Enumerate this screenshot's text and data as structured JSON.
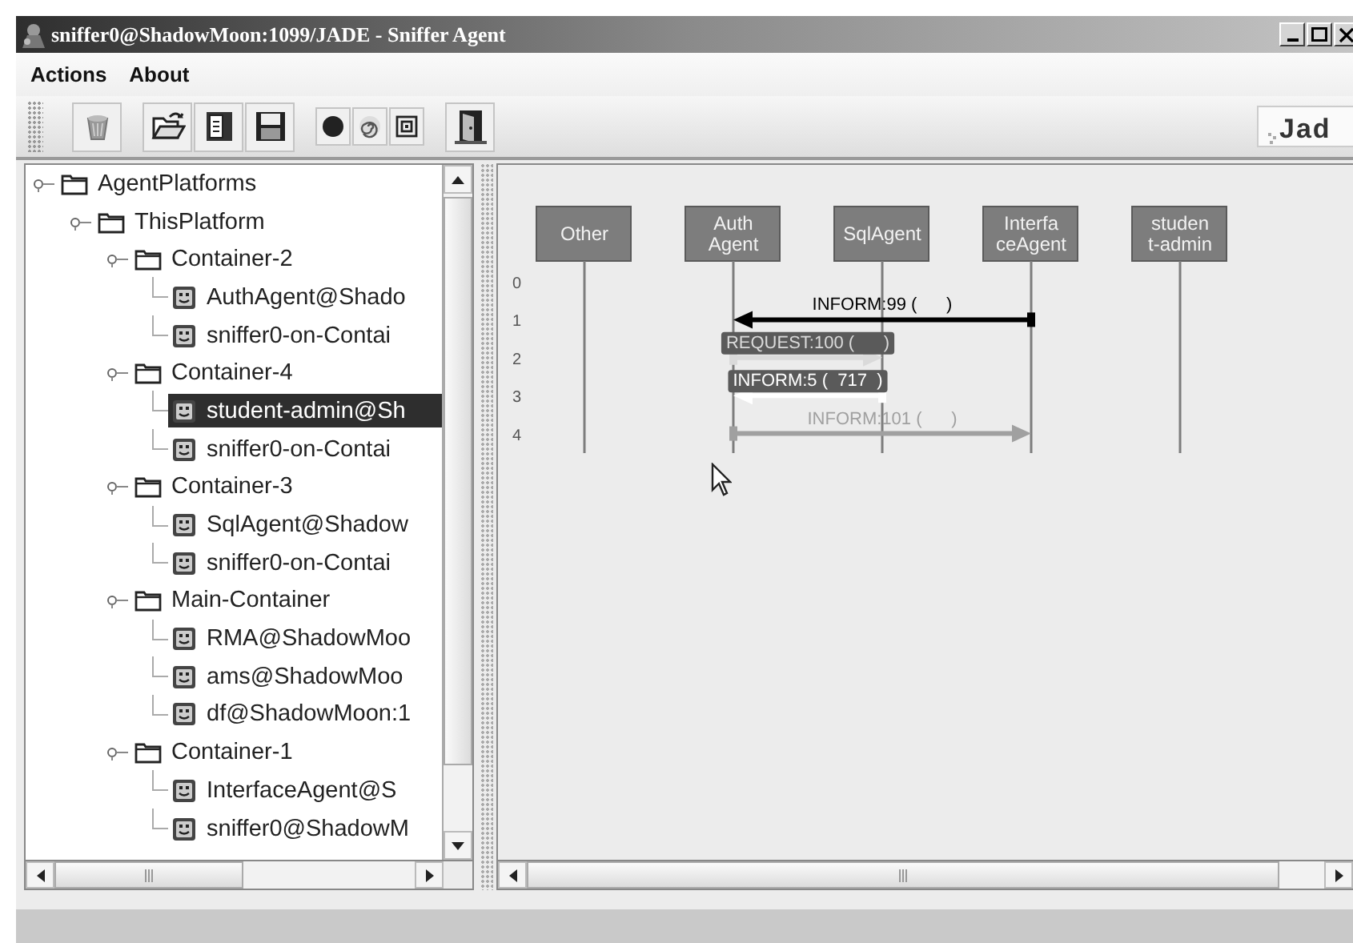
{
  "window": {
    "title": "sniffer0@ShadowMoon:1099/JADE - Sniffer Agent"
  },
  "menu": [
    "Actions",
    "About"
  ],
  "toolbar": {
    "groups": [
      [
        {
          "kind": "trash"
        }
      ],
      [
        {
          "kind": "open"
        },
        {
          "kind": "document"
        },
        {
          "kind": "floppy"
        }
      ],
      [
        {
          "kind": "dot"
        },
        {
          "kind": "spiral"
        },
        {
          "kind": "square"
        }
      ],
      [
        {
          "kind": "door"
        }
      ]
    ],
    "logo": "Jad"
  },
  "tree": [
    {
      "label": "AgentPlatforms",
      "kind": "folder",
      "expanded": true,
      "selected": false,
      "children": [
        {
          "label": "ThisPlatform",
          "kind": "folder",
          "expanded": true,
          "selected": false,
          "children": [
            {
              "label": "Container-2",
              "kind": "folder",
              "expanded": true,
              "selected": false,
              "children": [
                {
                  "label": "AuthAgent@Shado",
                  "kind": "agent",
                  "selected": false
                },
                {
                  "label": "sniffer0-on-Contai",
                  "kind": "agent",
                  "selected": false
                }
              ]
            },
            {
              "label": "Container-4",
              "kind": "folder",
              "expanded": true,
              "selected": false,
              "children": [
                {
                  "label": "student-admin@Sh",
                  "kind": "agent",
                  "selected": true
                },
                {
                  "label": "sniffer0-on-Contai",
                  "kind": "agent",
                  "selected": false
                }
              ]
            },
            {
              "label": "Container-3",
              "kind": "folder",
              "expanded": true,
              "selected": false,
              "children": [
                {
                  "label": "SqlAgent@Shadow",
                  "kind": "agent",
                  "selected": false
                },
                {
                  "label": "sniffer0-on-Contai",
                  "kind": "agent",
                  "selected": false
                }
              ]
            },
            {
              "label": "Main-Container",
              "kind": "folder",
              "expanded": true,
              "selected": false,
              "children": [
                {
                  "label": "RMA@ShadowMoo",
                  "kind": "agent",
                  "selected": false
                },
                {
                  "label": "ams@ShadowMoo",
                  "kind": "agent",
                  "selected": false
                },
                {
                  "label": "df@ShadowMoon:1",
                  "kind": "agent",
                  "selected": false
                }
              ]
            },
            {
              "label": "Container-1",
              "kind": "folder",
              "expanded": true,
              "selected": false,
              "children": [
                {
                  "label": "InterfaceAgent@S",
                  "kind": "agent",
                  "selected": false
                },
                {
                  "label": "sniffer0@ShadowM",
                  "kind": "agent",
                  "selected": false
                }
              ]
            }
          ]
        }
      ]
    }
  ],
  "diagram": {
    "agents": [
      {
        "label_lines": [
          "Other"
        ]
      },
      {
        "label_lines": [
          "Auth",
          "Agent"
        ]
      },
      {
        "label_lines": [
          "SqlAgent"
        ]
      },
      {
        "label_lines": [
          "Interfa",
          "ceAgent"
        ]
      },
      {
        "label_lines": [
          "studen",
          "t-admin"
        ]
      }
    ],
    "rows": [
      {
        "number": "0"
      },
      {
        "number": "1",
        "message": {
          "label": "INFORM:99 (      )",
          "color": "#000000",
          "lanes": [
            {
              "kind": "none"
            },
            {
              "kind": "head"
            },
            {
              "kind": "pass"
            },
            {
              "kind": "tail"
            },
            {
              "kind": "none"
            }
          ]
        }
      },
      {
        "number": "2",
        "message": {
          "label": "REQUEST:100 (      )",
          "color": "#dadada",
          "lanes": [
            {
              "kind": "none"
            },
            {
              "kind": "tail"
            },
            {
              "kind": "head"
            },
            {
              "kind": "none"
            },
            {
              "kind": "none"
            }
          ]
        }
      },
      {
        "number": "3",
        "message": {
          "label": "INFORM:5 (  717  )",
          "color": "#ffffff",
          "lanes": [
            {
              "kind": "none"
            },
            {
              "kind": "head"
            },
            {
              "kind": "tail"
            },
            {
              "kind": "none"
            },
            {
              "kind": "none"
            }
          ]
        }
      },
      {
        "number": "4",
        "message": {
          "label": "INFORM:101 (      )",
          "color": "#a0a0a0",
          "lanes": [
            {
              "kind": "none"
            },
            {
              "kind": "tail"
            },
            {
              "kind": "pass"
            },
            {
              "kind": "head"
            },
            {
              "kind": "none"
            }
          ]
        }
      }
    ]
  }
}
